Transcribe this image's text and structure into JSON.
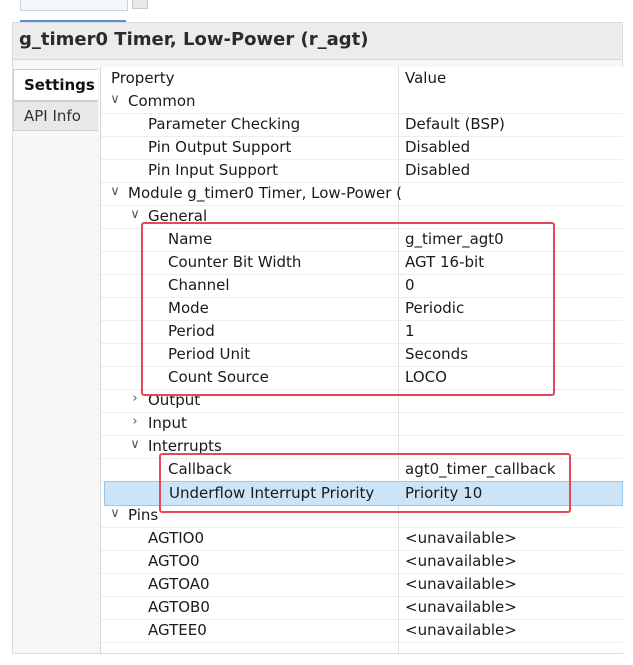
{
  "window": {
    "title": "g_timer0 Timer, Low-Power (r_agt)"
  },
  "side_tabs": [
    {
      "label": "Settings",
      "active": true
    },
    {
      "label": "API Info",
      "active": false
    }
  ],
  "table": {
    "headers": {
      "property": "Property",
      "value": "Value"
    },
    "rows": [
      {
        "name": "Common",
        "value": "",
        "expander": "expanded"
      },
      {
        "name": "Parameter Checking",
        "value": "Default (BSP)"
      },
      {
        "name": "Pin Output Support",
        "value": "Disabled"
      },
      {
        "name": "Pin Input Support",
        "value": "Disabled"
      },
      {
        "name": "Module g_timer0 Timer, Low-Power (",
        "value": "",
        "expander": "expanded"
      },
      {
        "name": "General",
        "value": "",
        "expander": "expanded"
      },
      {
        "name": "Name",
        "value": "g_timer_agt0"
      },
      {
        "name": "Counter Bit Width",
        "value": "AGT 16-bit"
      },
      {
        "name": "Channel",
        "value": "0"
      },
      {
        "name": "Mode",
        "value": "Periodic"
      },
      {
        "name": "Period",
        "value": "1"
      },
      {
        "name": "Period Unit",
        "value": "Seconds"
      },
      {
        "name": "Count Source",
        "value": "LOCO"
      },
      {
        "name": "Output",
        "value": "",
        "expander": "collapsed"
      },
      {
        "name": "Input",
        "value": "",
        "expander": "collapsed"
      },
      {
        "name": "Interrupts",
        "value": "",
        "expander": "expanded"
      },
      {
        "name": "Callback",
        "value": "agt0_timer_callback"
      },
      {
        "name": "Underflow Interrupt Priority",
        "value": "Priority 10",
        "selected": true
      },
      {
        "name": "Pins",
        "value": "",
        "expander": "expanded"
      },
      {
        "name": "AGTIO0",
        "value": "<unavailable>"
      },
      {
        "name": "AGTO0",
        "value": "<unavailable>"
      },
      {
        "name": "AGTOA0",
        "value": "<unavailable>"
      },
      {
        "name": "AGTOB0",
        "value": "<unavailable>"
      },
      {
        "name": "AGTEE0",
        "value": "<unavailable>"
      }
    ]
  },
  "colors": {
    "highlight_box": "#e5485a",
    "selection": "#cce4f7"
  },
  "icons": {
    "expanded": "chevron-down-icon",
    "collapsed": "chevron-right-icon"
  }
}
